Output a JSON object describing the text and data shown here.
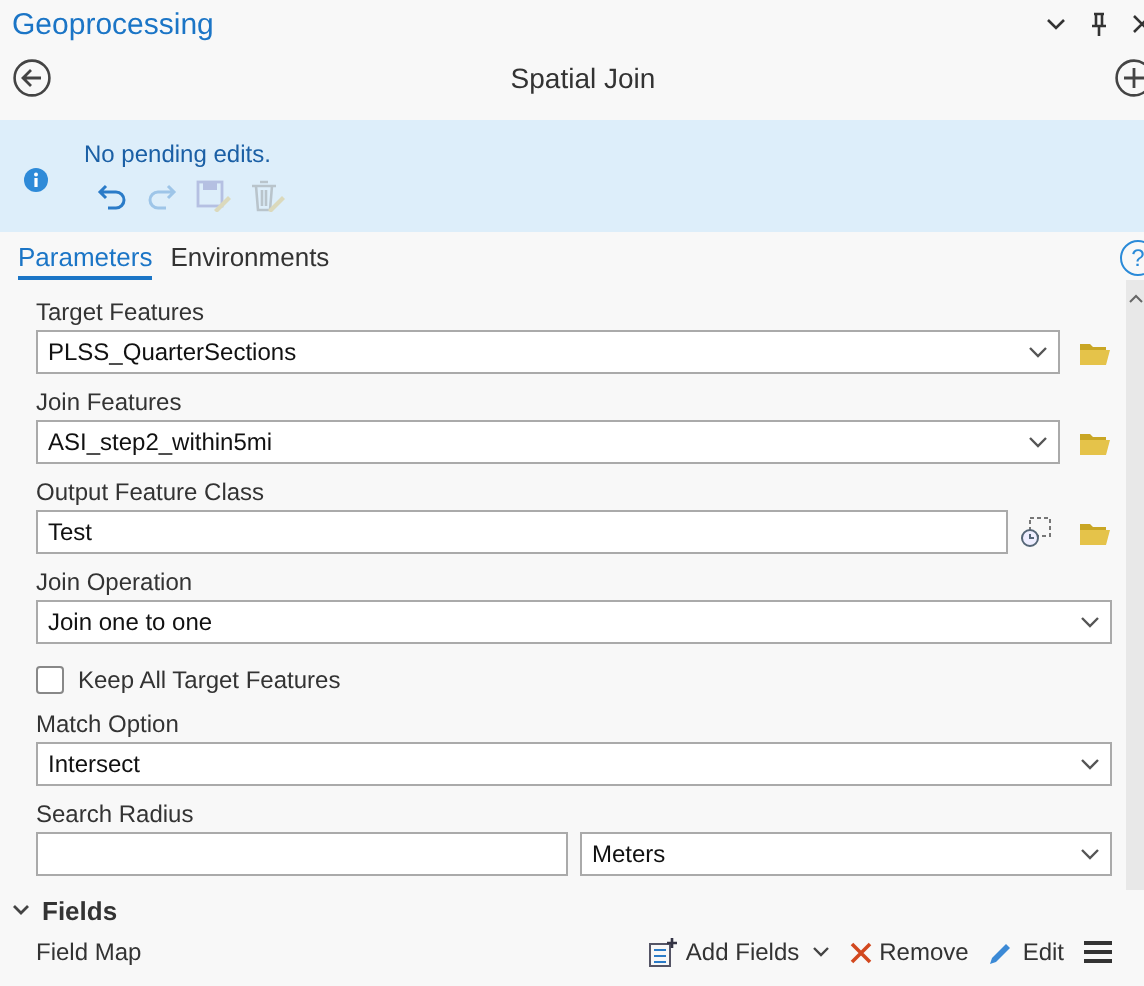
{
  "pane": {
    "title": "Geoprocessing"
  },
  "tool": {
    "title": "Spatial Join"
  },
  "banner": {
    "message": "No pending edits.",
    "tools": [
      {
        "kind": "undo",
        "disabled": false
      },
      {
        "kind": "redo",
        "disabled": true
      },
      {
        "kind": "save",
        "disabled": true
      },
      {
        "kind": "discard",
        "disabled": true
      }
    ]
  },
  "tabs": [
    {
      "label": "Parameters",
      "selected": true
    },
    {
      "label": "Environments",
      "selected": false
    }
  ],
  "help_glyph": "?",
  "parameters": [
    {
      "kind": "dropdown",
      "label": "Target Features",
      "value": "PLSS_QuarterSections",
      "browse": true
    },
    {
      "kind": "dropdown",
      "label": "Join Features",
      "value": "ASI_step2_within5mi",
      "browse": true
    },
    {
      "kind": "output",
      "label": "Output Feature Class",
      "value": "Test"
    },
    {
      "kind": "dropdown",
      "label": "Join Operation",
      "value": "Join one to one",
      "browse": false
    },
    {
      "kind": "checkbox",
      "label": "Keep All Target Features",
      "checked": false
    },
    {
      "kind": "dropdown",
      "label": "Match Option",
      "value": "Intersect",
      "browse": false
    },
    {
      "kind": "linear_unit",
      "label": "Search Radius",
      "unit": "Meters"
    }
  ],
  "fields": {
    "title": "Fields",
    "expanded": true,
    "label": "Field Map",
    "actions": [
      {
        "kind": "add",
        "label": "Add Fields"
      },
      {
        "kind": "remove",
        "label": "Remove"
      },
      {
        "kind": "edit",
        "label": "Edit"
      }
    ]
  }
}
